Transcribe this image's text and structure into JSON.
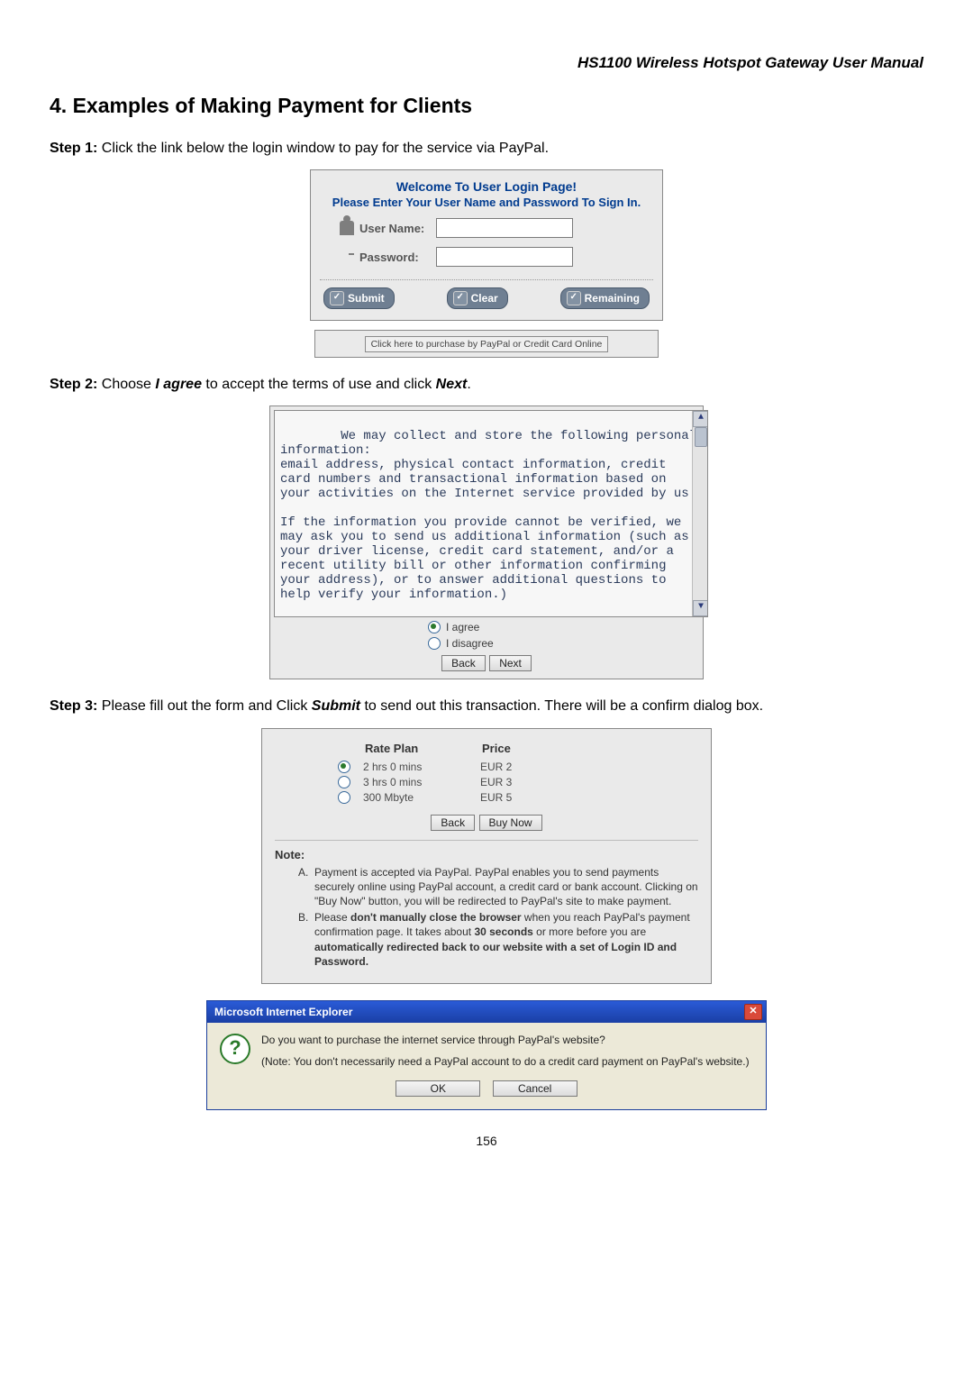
{
  "header": {
    "product_title": "HS1100 Wireless Hotspot Gateway User Manual"
  },
  "section": {
    "number": "4.",
    "title": "Examples of Making Payment for Clients"
  },
  "step1": {
    "label": "Step 1:",
    "text": " Click the link below the login window to pay for the service via PayPal."
  },
  "login_panel": {
    "title": "Welcome To User Login Page!",
    "subtitle": "Please Enter Your User Name and Password To Sign In.",
    "username_label": "User Name:",
    "password_label": "Password:",
    "submit": "Submit",
    "clear": "Clear",
    "remaining": "Remaining",
    "purchase_link": "Click here to purchase by PayPal or Credit Card Online"
  },
  "step2": {
    "label": "Step 2:",
    "text_before": " Choose ",
    "iagree": "I agree",
    "text_mid": " to accept the terms of use and click ",
    "next": "Next",
    "text_after": "."
  },
  "terms_panel": {
    "text": "We may collect and store the following personal information:\nemail address, physical contact information, credit card numbers and transactional information based on your activities on the Internet service provided by us.\n\nIf the information you provide cannot be verified, we may ask you to send us additional information (such as your driver license, credit card statement, and/or a recent utility bill or other information confirming your address), or to answer additional questions to help verify your information.)",
    "agree": "I agree",
    "disagree": "I disagree",
    "back": "Back",
    "next": "Next"
  },
  "step3": {
    "label": "Step 3:",
    "text_before": " Please fill out the form and Click ",
    "submit": "Submit",
    "text_after": " to send out this transaction. There will be a confirm dialog box."
  },
  "rate_panel": {
    "col_plan": "Rate Plan",
    "col_price": "Price",
    "plans": [
      {
        "plan": "2 hrs 0 mins",
        "price": "EUR 2",
        "selected": true
      },
      {
        "plan": "3 hrs 0 mins",
        "price": "EUR 3",
        "selected": false
      },
      {
        "plan": "300 Mbyte",
        "price": "EUR 5",
        "selected": false
      }
    ],
    "back": "Back",
    "buy_now": "Buy Now",
    "note_heading": "Note:",
    "note_a_marker": "A.",
    "note_a": "Payment is accepted via PayPal. PayPal enables you to send payments securely online using PayPal account, a credit card or bank account. Clicking on \"Buy Now\" button, you will be redirected to PayPal's site to make payment.",
    "note_b_marker": "B.",
    "note_b_before": "Please ",
    "note_b_bold1": "don't manually close the browser",
    "note_b_mid": " when you reach PayPal's payment confirmation page. It takes about ",
    "note_b_bold2": "30 seconds",
    "note_b_mid2": " or more before you are ",
    "note_b_bold3": "automatically redirected back to our website with a set of Login ID and Password."
  },
  "ie_dialog": {
    "title": "Microsoft Internet Explorer",
    "close": "✕",
    "question_icon": "?",
    "question": "Do you want to purchase the internet service through PayPal's website?",
    "note": "(Note: You don't necessarily need a PayPal account to do a credit card payment on PayPal's website.)",
    "ok": "OK",
    "cancel": "Cancel"
  },
  "page_number": "156"
}
